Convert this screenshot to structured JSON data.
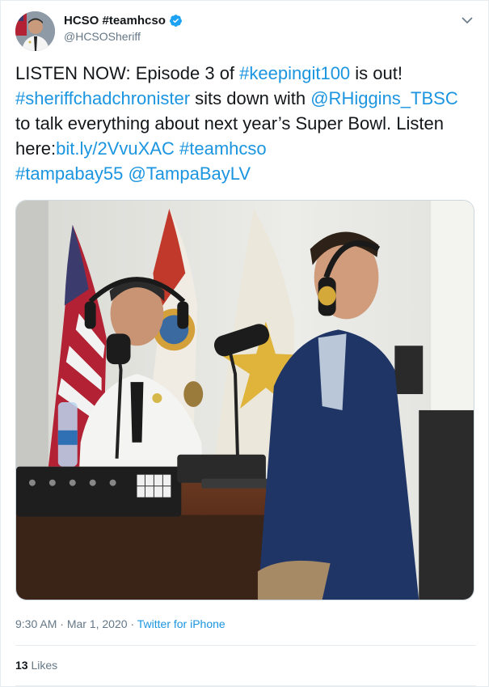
{
  "author": {
    "display_name": "HCSO #teamhcso",
    "handle": "@HCSOSheriff",
    "verified": true,
    "verified_color": "#1da1f2"
  },
  "tweet": {
    "segments": [
      {
        "text": "LISTEN NOW: Episode 3 of ",
        "link": false
      },
      {
        "text": "#keepingit100",
        "link": true
      },
      {
        "text": " is out! ",
        "link": false
      },
      {
        "text": "#sheriffchadchronister",
        "link": true
      },
      {
        "text": " sits down with ",
        "link": false
      },
      {
        "text": "@RHiggins_TBSC",
        "link": true
      },
      {
        "text": "  to talk everything about next year’s Super Bowl. Listen here:",
        "link": false
      },
      {
        "text": "bit.ly/2VvuXAC",
        "link": true
      },
      {
        "text": " ",
        "link": false
      },
      {
        "text": "#teamhcso",
        "link": true
      },
      {
        "text": "  ",
        "link": false
      },
      {
        "text": "#tampabay55",
        "link": true
      },
      {
        "text": " ",
        "link": false
      },
      {
        "text": "@TampaBayLV",
        "link": true
      }
    ],
    "link_color": "#1b95e0"
  },
  "meta": {
    "time": "9:30 AM",
    "separator": " · ",
    "date": "Mar 1, 2020",
    "source": "Twitter for iPhone"
  },
  "stats": {
    "likes_count": "13",
    "likes_label": "Likes"
  },
  "icons": {
    "caret": "chevron-down-icon",
    "verified": "verified-badge-icon"
  }
}
